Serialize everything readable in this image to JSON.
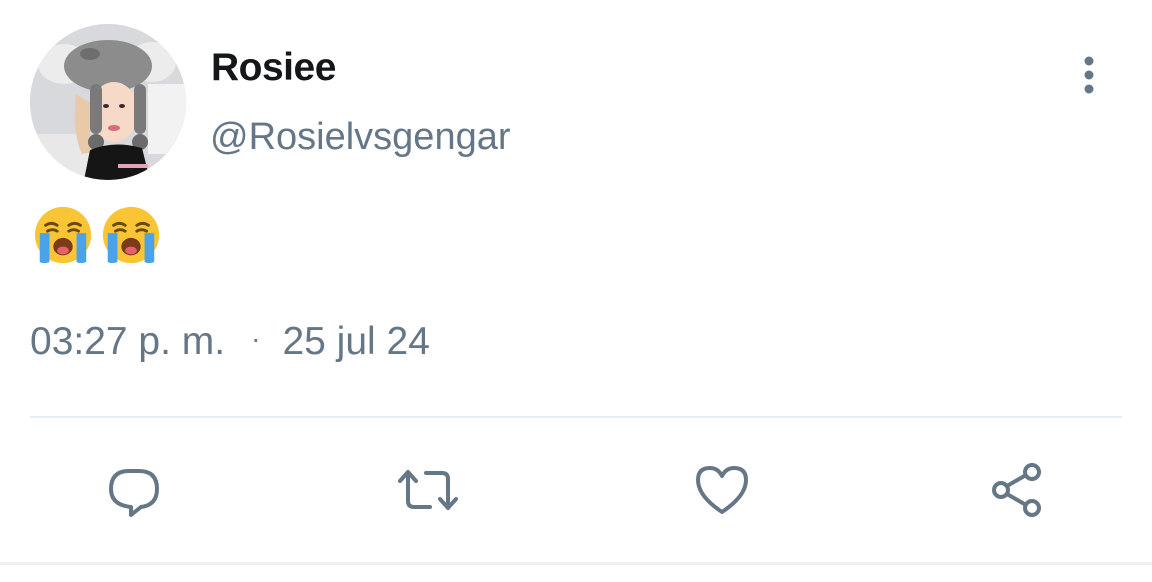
{
  "tweet": {
    "display_name": "Rosiee",
    "handle": "@Rosielvsgengar",
    "emojis": [
      "loudly-crying-face",
      "loudly-crying-face"
    ],
    "time": "03:27 p. m.",
    "separator": "·",
    "date": "25 jul 24"
  },
  "icons": {
    "more": "more-vertical-icon",
    "reply": "reply-icon",
    "retweet": "retweet-icon",
    "like": "heart-icon",
    "share": "share-icon"
  },
  "colors": {
    "text_primary": "#14171a",
    "text_secondary": "#657786",
    "icon": "#657786",
    "divider": "#e6ecf0"
  }
}
